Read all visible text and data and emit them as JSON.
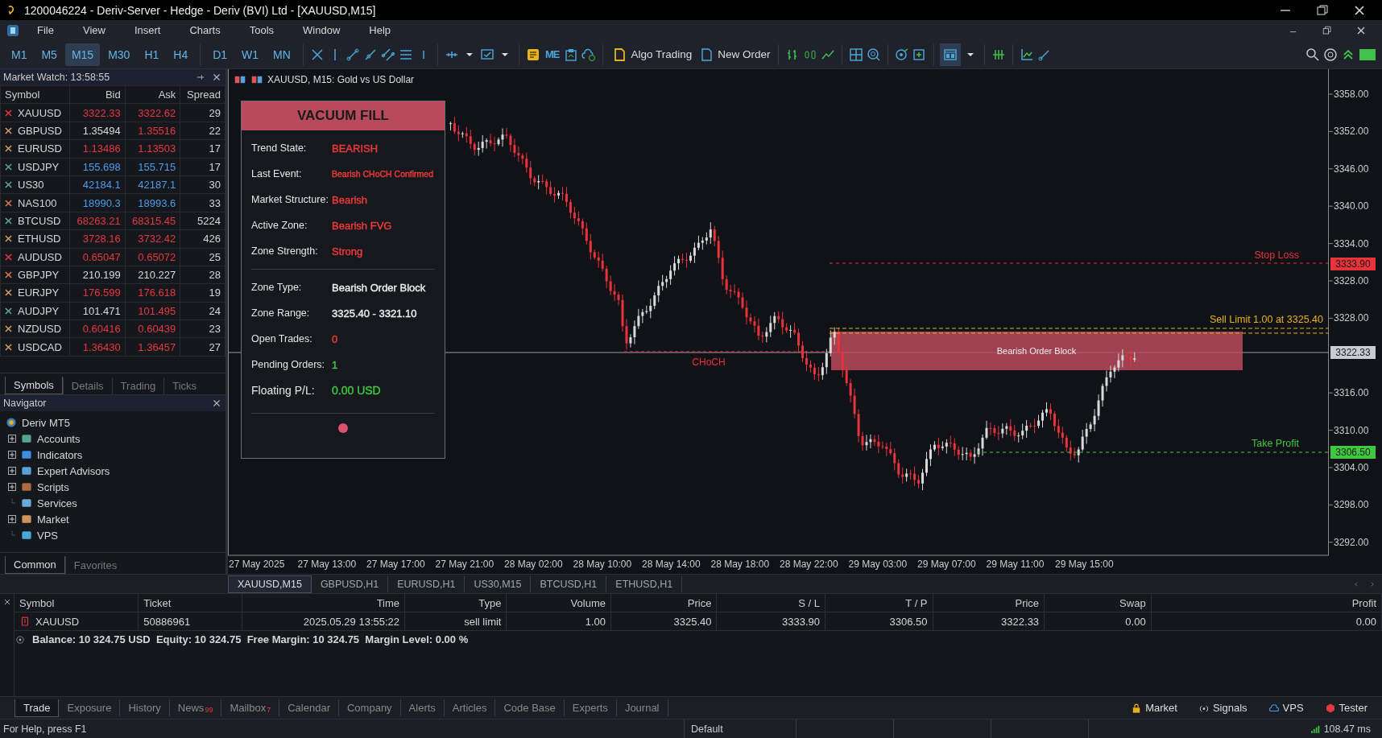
{
  "window": {
    "title": "1200046224 - Deriv-Server - Hedge - Deriv (BVI) Ltd - [XAUUSD,M15]"
  },
  "menu": [
    "File",
    "View",
    "Insert",
    "Charts",
    "Tools",
    "Window",
    "Help"
  ],
  "timeframes": [
    {
      "label": "M1",
      "selected": false
    },
    {
      "label": "M5",
      "selected": false
    },
    {
      "label": "M15",
      "selected": true
    },
    {
      "label": "M30",
      "selected": false
    },
    {
      "label": "H1",
      "selected": false
    },
    {
      "label": "H4",
      "selected": false
    },
    {
      "label": "D1",
      "selected": false
    },
    {
      "label": "W1",
      "selected": false
    },
    {
      "label": "MN",
      "selected": false
    }
  ],
  "toolbar": {
    "editor_label": "ME",
    "algo_trading": "Algo Trading",
    "new_order": "New Order"
  },
  "market_watch": {
    "title": "Market Watch: 13:58:55",
    "columns": [
      "Symbol",
      "Bid",
      "Ask",
      "Spread"
    ],
    "rows": [
      {
        "symbol": "XAUUSD",
        "bid": {
          "text": "3322.33",
          "color": "#e5383f"
        },
        "ask": {
          "text": "3322.62",
          "color": "#e5383f"
        },
        "spread": "29",
        "color": "#e5383f"
      },
      {
        "symbol": "GBPUSD",
        "bid": {
          "text": "1.35494",
          "color": "#d8d8d8"
        },
        "ask": {
          "text": "1.35516",
          "color": "#e5383f"
        },
        "spread": "22",
        "color": "#d9a064"
      },
      {
        "symbol": "EURUSD",
        "bid": {
          "text": "1.13486",
          "color": "#e5383f"
        },
        "ask": {
          "text": "1.13503",
          "color": "#e5383f"
        },
        "spread": "17",
        "color": "#d9a064"
      },
      {
        "symbol": "USDJPY",
        "bid": {
          "text": "155.698",
          "color": "#4a9de8"
        },
        "ask": {
          "text": "155.715",
          "color": "#4a9de8"
        },
        "spread": "17",
        "color": "#5fa89a"
      },
      {
        "symbol": "US30",
        "bid": {
          "text": "42184.1",
          "color": "#4a9de8"
        },
        "ask": {
          "text": "42187.1",
          "color": "#4a9de8"
        },
        "spread": "30",
        "color": "#5fa89a"
      },
      {
        "symbol": "NAS100",
        "bid": {
          "text": "18990.3",
          "color": "#4a9de8"
        },
        "ask": {
          "text": "18993.6",
          "color": "#4a9de8"
        },
        "spread": "33",
        "color": "#e07a50"
      },
      {
        "symbol": "BTCUSD",
        "bid": {
          "text": "68263.21",
          "color": "#e5383f"
        },
        "ask": {
          "text": "68315.45",
          "color": "#e5383f"
        },
        "spread": "5224",
        "color": "#5fa89a"
      },
      {
        "symbol": "ETHUSD",
        "bid": {
          "text": "3728.16",
          "color": "#e5383f"
        },
        "ask": {
          "text": "3732.42",
          "color": "#e5383f"
        },
        "spread": "426",
        "color": "#d9a064"
      },
      {
        "symbol": "AUDUSD",
        "bid": {
          "text": "0.65047",
          "color": "#e5383f"
        },
        "ask": {
          "text": "0.65072",
          "color": "#e5383f"
        },
        "spread": "25",
        "color": "#e5383f"
      },
      {
        "symbol": "GBPJPY",
        "bid": {
          "text": "210.199",
          "color": "#d8d8d8"
        },
        "ask": {
          "text": "210.227",
          "color": "#d8d8d8"
        },
        "spread": "28",
        "color": "#e07a50"
      },
      {
        "symbol": "EURJPY",
        "bid": {
          "text": "176.599",
          "color": "#e5383f"
        },
        "ask": {
          "text": "176.618",
          "color": "#e5383f"
        },
        "spread": "19",
        "color": "#d9a064"
      },
      {
        "symbol": "AUDJPY",
        "bid": {
          "text": "101.471",
          "color": "#d8d8d8"
        },
        "ask": {
          "text": "101.495",
          "color": "#e5383f"
        },
        "spread": "24",
        "color": "#5fa89a"
      },
      {
        "symbol": "NZDUSD",
        "bid": {
          "text": "0.60416",
          "color": "#e5383f"
        },
        "ask": {
          "text": "0.60439",
          "color": "#e5383f"
        },
        "spread": "23",
        "color": "#d9a064"
      },
      {
        "symbol": "USDCAD",
        "bid": {
          "text": "1.36430",
          "color": "#e5383f"
        },
        "ask": {
          "text": "1.36457",
          "color": "#e5383f"
        },
        "spread": "27",
        "color": "#d9a064"
      }
    ],
    "tabs": [
      {
        "label": "Symbols",
        "selected": true
      },
      {
        "label": "Details",
        "selected": false
      },
      {
        "label": "Trading",
        "selected": false
      },
      {
        "label": "Ticks",
        "selected": false
      }
    ]
  },
  "navigator": {
    "title": "Navigator",
    "tree": [
      {
        "label": "Deriv MT5",
        "children": [
          {
            "label": "Accounts",
            "expandable": true
          },
          {
            "label": "Indicators",
            "expandable": true
          },
          {
            "label": "Expert Advisors",
            "expandable": true
          },
          {
            "label": "Scripts",
            "expandable": true
          },
          {
            "label": "Services",
            "expandable": false
          },
          {
            "label": "Market",
            "expandable": true
          },
          {
            "label": "VPS",
            "expandable": false
          }
        ]
      }
    ],
    "tabs": [
      {
        "label": "Common",
        "selected": true
      },
      {
        "label": "Favorites",
        "selected": false
      }
    ]
  },
  "chart": {
    "title": "XAUUSD, M15: Gold vs US Dollar",
    "price_labels": [
      "3358.00",
      "3352.00",
      "3346.00",
      "3340.00",
      "3334.00",
      "3328.00",
      "3328.00",
      "3316.00",
      "3310.00",
      "3304.00",
      "3298.00",
      "3292.00"
    ],
    "time_labels": [
      "27 May 2025",
      "27 May 13:00",
      "27 May 17:00",
      "27 May 21:00",
      "28 May 02:00",
      "28 May 10:00",
      "28 May 14:00",
      "28 May 18:00",
      "28 May 22:00",
      "29 May 03:00",
      "29 May 07:00",
      "29 May 11:00",
      "29 May 15:00"
    ],
    "current_price": "3322.33",
    "stop_loss": {
      "label": "Stop Loss",
      "price": "3333.90"
    },
    "sell_limit": {
      "label": "Sell Limit 1.00 at 3325.40"
    },
    "take_profit": {
      "label": "Take Profit",
      "price": "3306.50"
    },
    "zone_label": "Bearish Order Block",
    "choch_label": "CHoCH"
  },
  "info_panel": {
    "title": "VACUUM FILL",
    "sections": [
      {
        "rows": [
          {
            "label": "Trend State:",
            "value": "BEARISH",
            "color": "#ee3a3a",
            "kind": "normal"
          },
          {
            "label": "Last Event:",
            "value": "Bearish CHoCH Confirmed",
            "color": "#ee3a3a",
            "kind": "small"
          },
          {
            "label": "Market Structure:",
            "value": "Bearish",
            "color": "#ee3a3a",
            "kind": "normal"
          },
          {
            "label": "Active Zone:",
            "value": "Bearish FVG",
            "color": "#ee3a3a",
            "kind": "normal"
          },
          {
            "label": "Zone Strength:",
            "value": "Strong",
            "color": "#ee3a3a",
            "kind": "normal"
          }
        ]
      },
      {
        "rows": [
          {
            "label": "Zone Type:",
            "value": "Bearish Order Block",
            "color": "#ececec",
            "kind": "normal"
          },
          {
            "label": "Zone Range:",
            "value": "3325.40 - 3321.10",
            "color": "#ececec",
            "kind": "normal"
          },
          {
            "label": "Open Trades:",
            "value": "0",
            "color": "#ee3a3a",
            "kind": "normal"
          },
          {
            "label": "Pending Orders:",
            "value": "1",
            "color": "#3ec83e",
            "kind": "normal"
          },
          {
            "label": "Floating P/L:",
            "value": "0.00 USD",
            "color": "#3ec83e",
            "kind": "large"
          }
        ]
      }
    ],
    "indicator": {
      "color": "#d9536a"
    }
  },
  "chart_tabs": [
    {
      "label": "XAUUSD,M15",
      "selected": true
    },
    {
      "label": "GBPUSD,H1",
      "selected": false
    },
    {
      "label": "EURUSD,H1",
      "selected": false
    },
    {
      "label": "US30,M15",
      "selected": false
    },
    {
      "label": "BTCUSD,H1",
      "selected": false
    },
    {
      "label": "ETHUSD,H1",
      "selected": false
    }
  ],
  "trade": {
    "columns": [
      "Symbol",
      "Ticket",
      "Time",
      "Type",
      "Volume",
      "Price",
      "S / L",
      "T / P",
      "Price",
      "Swap",
      "Profit"
    ],
    "rows": [
      {
        "cells": [
          "XAUUSD",
          "50886961",
          "2025.05.29 13:55:22",
          "sell limit",
          "1.00",
          "3325.40",
          "3333.90",
          "3306.50",
          "3322.33",
          "0.00",
          "0.00"
        ]
      }
    ],
    "summary": "Balance: 10 324.75 USD  Equity: 10 324.75  Free Margin: 10 324.75  Margin Level: 0.00 %"
  },
  "bottom_tabs": [
    {
      "label": "Trade",
      "selected": true
    },
    {
      "label": "Exposure",
      "selected": false
    },
    {
      "label": "History",
      "selected": false
    },
    {
      "label": "News",
      "selected": false,
      "badge": "99"
    },
    {
      "label": "Mailbox",
      "selected": false,
      "badge": "7"
    },
    {
      "label": "Calendar",
      "selected": false
    },
    {
      "label": "Company",
      "selected": false
    },
    {
      "label": "Alerts",
      "selected": false
    },
    {
      "label": "Articles",
      "selected": false
    },
    {
      "label": "Code Base",
      "selected": false
    },
    {
      "label": "Experts",
      "selected": false
    },
    {
      "label": "Journal",
      "selected": false
    }
  ],
  "bottom_links": [
    "Market",
    "Signals",
    "VPS",
    "Tester"
  ],
  "status_bar": {
    "help": "For Help, press F1",
    "profile": "Default",
    "ping": "108.47 ms"
  }
}
